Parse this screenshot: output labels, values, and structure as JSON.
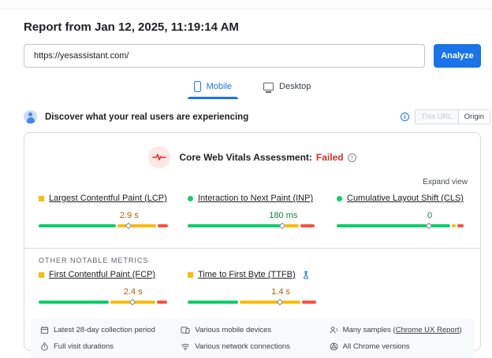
{
  "colors": {
    "accent_blue": "#1a73e8",
    "bar_green": "#0cce6b",
    "bar_orange": "#fbbc04",
    "bar_red": "#ff4e42",
    "text_green": "#188038",
    "text_orange": "#b06000",
    "failed_red": "#d93025"
  },
  "header": {
    "title": "Report from Jan 12, 2025, 11:19:14 AM"
  },
  "url_form": {
    "url_value": "https://yesassistant.com/",
    "analyze_label": "Analyze"
  },
  "tabs": {
    "mobile": "Mobile",
    "desktop": "Desktop"
  },
  "field_data": {
    "section_title": "Discover what your real users are experiencing",
    "scope_toggle": {
      "this_url": "This URL",
      "origin": "Origin",
      "selected": "Origin"
    },
    "assessment_label": "Core Web Vitals Assessment:",
    "assessment_status": "Failed",
    "expand_view": "Expand view",
    "core_metrics": [
      {
        "id": "lcp",
        "name": "Largest Contentful Paint (LCP)",
        "value": "2.9 s",
        "rating": "orange",
        "shape": "square",
        "bar": {
          "green": 60,
          "orange": 30,
          "red": 8
        },
        "marker_pct": 70
      },
      {
        "id": "inp",
        "name": "Interaction to Next Paint (INP)",
        "value": "180 ms",
        "rating": "green",
        "shape": "circle",
        "bar": {
          "green": 74,
          "orange": 11,
          "red": 11
        },
        "marker_pct": 74
      },
      {
        "id": "cls",
        "name": "Cumulative Layout Shift (CLS)",
        "value": "0",
        "rating": "green",
        "shape": "circle",
        "bar": {
          "green": 88,
          "orange": 3,
          "red": 5
        },
        "marker_pct": 72
      }
    ],
    "other_metrics_label": "OTHER NOTABLE METRICS",
    "other_metrics": [
      {
        "id": "fcp",
        "name": "First Contentful Paint (FCP)",
        "value": "2.4 s",
        "rating": "orange",
        "shape": "square",
        "bar": {
          "green": 54,
          "orange": 35,
          "red": 8
        },
        "marker_pct": 73
      },
      {
        "id": "ttfb",
        "name": "Time to First Byte (TTFB)",
        "value": "1.4 s",
        "rating": "orange",
        "shape": "square",
        "flask": true,
        "bar": {
          "green": 39,
          "orange": 47,
          "red": 11
        },
        "marker_pct": 72
      }
    ],
    "metadata": [
      {
        "icon": "calendar-icon",
        "text": "Latest 28-day collection period"
      },
      {
        "icon": "devices-icon",
        "text": "Various mobile devices"
      },
      {
        "icon": "samples-icon",
        "text_prefix": "Many samples (",
        "link": "Chrome UX Report",
        "text_suffix": ")"
      },
      {
        "icon": "stopwatch-icon",
        "text": "Full visit durations"
      },
      {
        "icon": "network-icon",
        "text": "Various network connections"
      },
      {
        "icon": "chrome-icon",
        "text": "All Chrome versions"
      }
    ]
  }
}
